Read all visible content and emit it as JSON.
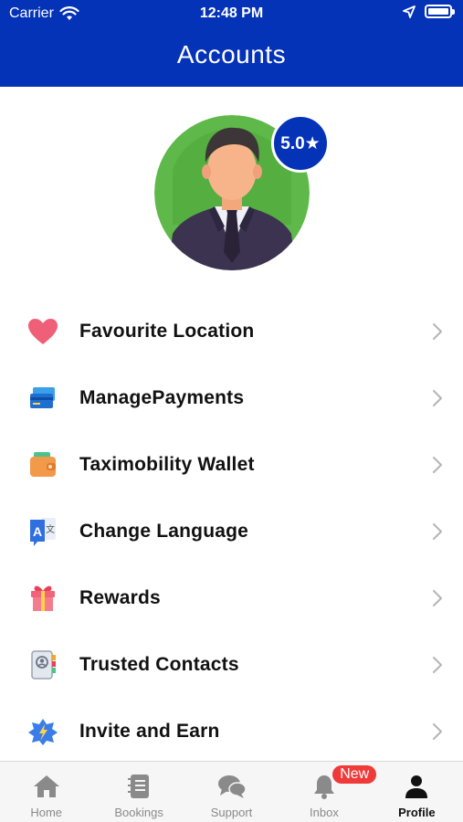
{
  "status_bar": {
    "carrier": "Carrier",
    "time": "12:48 PM"
  },
  "header": {
    "title": "Accounts",
    "background_color": "#0533b8"
  },
  "profile": {
    "rating": "5.0★"
  },
  "menu": {
    "items": [
      {
        "label": "Favourite Location",
        "icon": "heart-icon"
      },
      {
        "label": "ManagePayments",
        "icon": "credit-card-icon"
      },
      {
        "label": "Taximobility Wallet",
        "icon": "wallet-icon"
      },
      {
        "label": "Change Language",
        "icon": "translate-icon"
      },
      {
        "label": "Rewards",
        "icon": "gift-icon"
      },
      {
        "label": "Trusted Contacts",
        "icon": "contacts-icon"
      },
      {
        "label": "Invite and Earn",
        "icon": "invite-icon"
      }
    ]
  },
  "tabbar": {
    "tabs": [
      {
        "label": "Home",
        "icon": "home-icon"
      },
      {
        "label": "Bookings",
        "icon": "bookings-icon"
      },
      {
        "label": "Support",
        "icon": "chat-bubbles-icon"
      },
      {
        "label": "Inbox",
        "icon": "bell-icon",
        "badge": "New"
      },
      {
        "label": "Profile",
        "icon": "user-icon",
        "active": true
      }
    ]
  }
}
